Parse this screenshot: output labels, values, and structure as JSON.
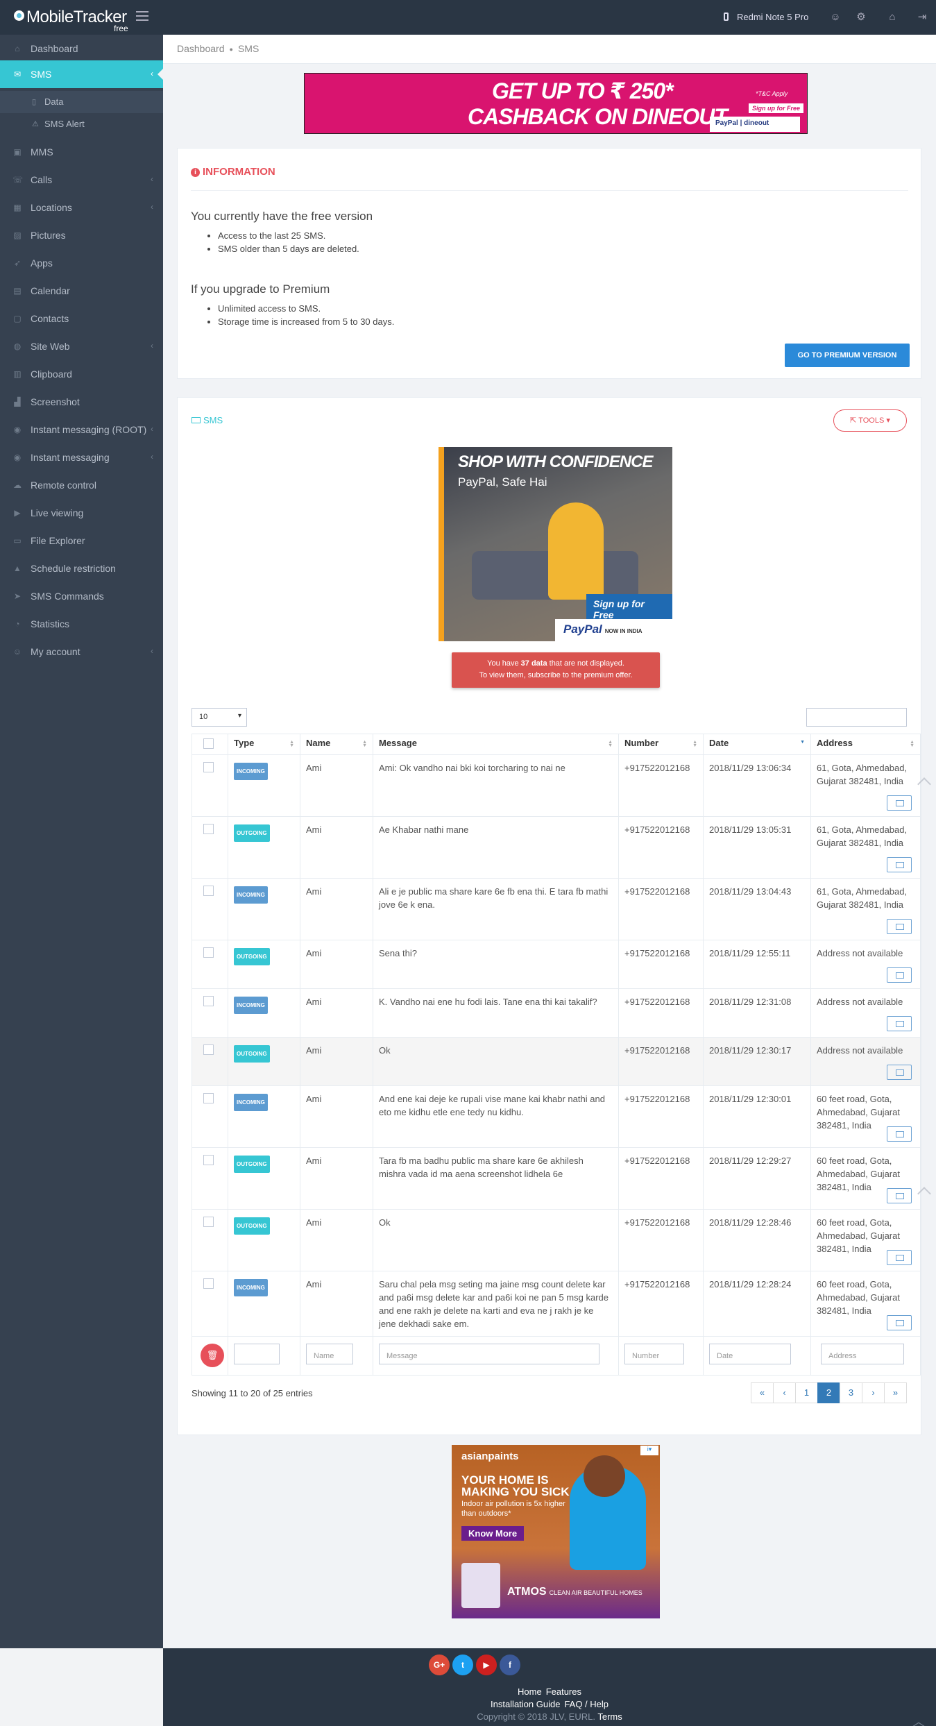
{
  "app": {
    "name": "MobileTracker",
    "edition": "free",
    "device": "Redmi Note 5 Pro"
  },
  "topbar_icons": [
    "phone-icon",
    "user-icon",
    "users-cog-icon",
    "basket-icon",
    "logout-icon"
  ],
  "sidebar": {
    "items": [
      {
        "label": "Dashboard",
        "icon": "home-icon",
        "chevron": false
      },
      {
        "label": "SMS",
        "icon": "envelope-icon",
        "chevron": true,
        "active": true
      },
      {
        "label": "MMS",
        "icon": "image-icon",
        "chevron": false
      },
      {
        "label": "Calls",
        "icon": "phone-icon",
        "chevron": true
      },
      {
        "label": "Locations",
        "icon": "map-icon",
        "chevron": true
      },
      {
        "label": "Pictures",
        "icon": "picture-icon",
        "chevron": false
      },
      {
        "label": "Apps",
        "icon": "rocket-icon",
        "chevron": false
      },
      {
        "label": "Calendar",
        "icon": "calendar-icon",
        "chevron": false
      },
      {
        "label": "Contacts",
        "icon": "contacts-icon",
        "chevron": false
      },
      {
        "label": "Site Web",
        "icon": "globe-icon",
        "chevron": true
      },
      {
        "label": "Clipboard",
        "icon": "clipboard-icon",
        "chevron": false
      },
      {
        "label": "Screenshot",
        "icon": "screenshot-icon",
        "chevron": false
      },
      {
        "label": "Instant messaging (ROOT)",
        "icon": "eye-icon",
        "chevron": true
      },
      {
        "label": "Instant messaging",
        "icon": "eye-icon",
        "chevron": true
      },
      {
        "label": "Remote control",
        "icon": "cloud-icon",
        "chevron": false
      },
      {
        "label": "Live viewing",
        "icon": "video-icon",
        "chevron": false
      },
      {
        "label": "File Explorer",
        "icon": "folder-icon",
        "chevron": false
      },
      {
        "label": "Schedule restriction",
        "icon": "lock-icon",
        "chevron": false
      },
      {
        "label": "SMS Commands",
        "icon": "send-icon",
        "chevron": false
      },
      {
        "label": "Statistics",
        "icon": "pie-chart-icon",
        "chevron": false
      },
      {
        "label": "My account",
        "icon": "user-icon",
        "chevron": true
      }
    ],
    "sms_subitems": [
      {
        "label": "Data",
        "icon": "file-icon",
        "selected": true
      },
      {
        "label": "SMS Alert",
        "icon": "warning-icon",
        "selected": false
      }
    ]
  },
  "breadcrumb": {
    "root": "Dashboard",
    "current": "SMS"
  },
  "ad_top": {
    "line1": "GET UP TO ₹ 250*",
    "line2": "CASHBACK ON DINEOUT",
    "tc": "*T&C Apply",
    "signup": "Sign up for Free",
    "brands": "PayPal  |  dineout"
  },
  "info": {
    "caption": "INFORMATION",
    "free_title": "You currently have the free version",
    "free_points": [
      "Access to the last 25 SMS.",
      "SMS older than 5 days are deleted."
    ],
    "premium_title": "If you upgrade to Premium",
    "premium_points": [
      "Unlimited access to SMS.",
      "Storage time is increased from 5 to 30 days."
    ],
    "button": "GO TO PREMIUM VERSION"
  },
  "sms_panel": {
    "caption": "SMS",
    "tools_label": "TOOLS",
    "ad": {
      "headline": "SHOP WITH CONFIDENCE",
      "subline": "PayPal, Safe Hai",
      "signup": "Sign up for Free",
      "brand": "PayPal",
      "brand_note": "NOW IN INDIA"
    },
    "notice_line1_pre": "You have ",
    "notice_count": "37 data",
    "notice_line1_post": " that are not displayed.",
    "notice_line2": "To view them, subscribe to the premium offer.",
    "page_length": "10",
    "columns": [
      "Type",
      "Name",
      "Message",
      "Number",
      "Date",
      "Address"
    ],
    "rows": [
      {
        "type": "INCOMING",
        "name": "Ami",
        "message": "Ami: Ok vandho nai bki koi torcharing to nai ne",
        "number": "+917522012168",
        "date": "2018/11/29 13:06:34",
        "address": "61, Gota, Ahmedabad, Gujarat 382481, India"
      },
      {
        "type": "OUTGOING",
        "name": "Ami",
        "message": "Ae Khabar nathi mane",
        "number": "+917522012168",
        "date": "2018/11/29 13:05:31",
        "address": "61, Gota, Ahmedabad, Gujarat 382481, India"
      },
      {
        "type": "INCOMING",
        "name": "Ami",
        "message": "Ali e je public ma share kare 6e fb ena thi. E tara fb mathi jove 6e k ena.",
        "number": "+917522012168",
        "date": "2018/11/29 13:04:43",
        "address": "61, Gota, Ahmedabad, Gujarat 382481, India"
      },
      {
        "type": "OUTGOING",
        "name": "Ami",
        "message": "Sena thi?",
        "number": "+917522012168",
        "date": "2018/11/29 12:55:11",
        "address": "Address not available"
      },
      {
        "type": "INCOMING",
        "name": "Ami",
        "message": "K. Vandho nai ene hu fodi lais. Tane ena thi kai takalif?",
        "number": "+917522012168",
        "date": "2018/11/29 12:31:08",
        "address": "Address not available"
      },
      {
        "type": "OUTGOING",
        "name": "Ami",
        "message": "Ok",
        "number": "+917522012168",
        "date": "2018/11/29 12:30:17",
        "address": "Address not available"
      },
      {
        "type": "INCOMING",
        "name": "Ami",
        "message": "And ene kai deje ke rupali vise mane kai khabr nathi and eto me kidhu etle ene tedy nu kidhu.",
        "number": "+917522012168",
        "date": "2018/11/29 12:30:01",
        "address": "60 feet road, Gota, Ahmedabad, Gujarat 382481, India"
      },
      {
        "type": "OUTGOING",
        "name": "Ami",
        "message": "Tara fb ma badhu public ma share kare 6e akhilesh mishra vada id ma aena screenshot lidhela 6e",
        "number": "+917522012168",
        "date": "2018/11/29 12:29:27",
        "address": "60 feet road, Gota, Ahmedabad, Gujarat 382481, India"
      },
      {
        "type": "OUTGOING",
        "name": "Ami",
        "message": "Ok",
        "number": "+917522012168",
        "date": "2018/11/29 12:28:46",
        "address": "60 feet road, Gota, Ahmedabad, Gujarat 382481, India"
      },
      {
        "type": "INCOMING",
        "name": "Ami",
        "message": "Saru chal pela msg seting ma jaine msg count delete kar and pa6i msg delete kar and pa6i koi ne pan 5 msg karde and ene rakh je delete na karti and eva ne j rakh je ke jene dekhadi sake em.",
        "number": "+917522012168",
        "date": "2018/11/29 12:28:24",
        "address": "60 feet road, Gota, Ahmedabad, Gujarat 382481, India"
      }
    ],
    "filters": {
      "name": "Name",
      "message": "Message",
      "number": "Number",
      "date": "Date",
      "address": "Address"
    },
    "showing": "Showing 11 to 20 of 25 entries",
    "pager": [
      "«",
      "‹",
      "1",
      "2",
      "3",
      "›",
      "»"
    ],
    "current_page": "2"
  },
  "ad_bottom": {
    "brand": "asianpaints",
    "headline": "YOUR HOME IS MAKING YOU SICK",
    "sub": "Indoor air pollution is 5x higher than outdoors*",
    "cta": "Know More",
    "product": "ATMOS",
    "product_note": "CLEAN AIR BEAUTIFUL HOMES"
  },
  "footer": {
    "social": [
      "G+",
      "t",
      "▶",
      "f"
    ],
    "links": [
      "Home",
      "Features",
      "Installation Guide",
      "FAQ / Help"
    ],
    "copyright": "Copyright © 2018 JLV, EURL.",
    "terms": "Terms"
  },
  "colors": {
    "topbar": "#2a3644",
    "sidebar": "#364150",
    "accent": "#36c6d3",
    "danger": "#e7505a",
    "primary": "#2b8ad9"
  }
}
